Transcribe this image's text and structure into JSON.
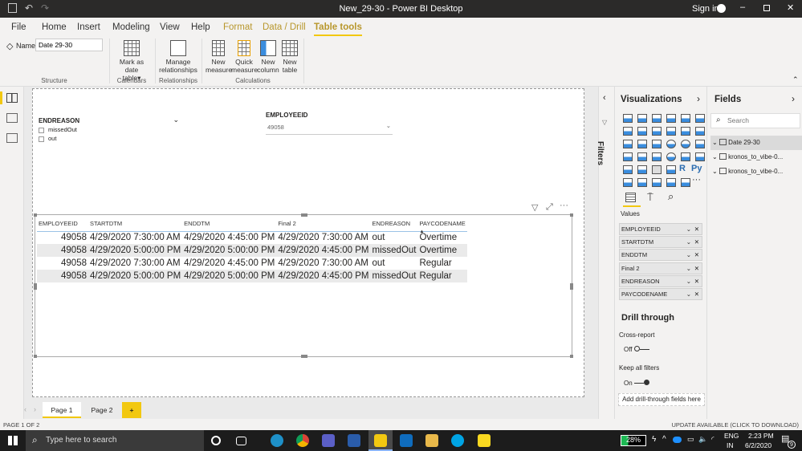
{
  "window": {
    "title": "New_29-30 - Power BI Desktop",
    "signin": "Sign in"
  },
  "menu": [
    "File",
    "Home",
    "Insert",
    "Modeling",
    "View",
    "Help",
    "Format",
    "Data / Drill",
    "Table tools"
  ],
  "ribbon": {
    "name_label": "Name",
    "name_value": "Date 29-30",
    "buttons": {
      "mark_date": "Mark as date",
      "mark_date2": "table",
      "manage": "Manage",
      "manage2": "relationships",
      "new_measure": "New",
      "new_measure2": "measure",
      "quick_measure": "Quick",
      "quick_measure2": "measure",
      "new_column": "New",
      "new_column2": "column",
      "new_table": "New",
      "new_table2": "table"
    },
    "groups": {
      "structure": "Structure",
      "calendars": "Calendars",
      "relationships": "Relationships",
      "calculations": "Calculations"
    }
  },
  "slicer1": {
    "title": "ENDREASON",
    "items": [
      "missedOut",
      "out"
    ]
  },
  "slicer2": {
    "title": "EMPLOYEEID",
    "value": "49058"
  },
  "table": {
    "columns": [
      "EMPLOYEEID",
      "STARTDTM",
      "ENDDTM",
      "Final 2",
      "ENDREASON",
      "PAYCODENAME"
    ],
    "rows": [
      [
        "49058",
        "4/29/2020 7:30:00 AM",
        "4/29/2020 4:45:00 PM",
        "4/29/2020 7:30:00 AM",
        "out",
        "Overtime"
      ],
      [
        "49058",
        "4/29/2020 5:00:00 PM",
        "4/29/2020 5:00:00 PM",
        "4/29/2020 4:45:00 PM",
        "missedOut",
        "Overtime"
      ],
      [
        "49058",
        "4/29/2020 7:30:00 AM",
        "4/29/2020 4:45:00 PM",
        "4/29/2020 7:30:00 AM",
        "out",
        "Regular"
      ],
      [
        "49058",
        "4/29/2020 5:00:00 PM",
        "4/29/2020 5:00:00 PM",
        "4/29/2020 4:45:00 PM",
        "missedOut",
        "Regular"
      ]
    ]
  },
  "filters": {
    "label": "Filters"
  },
  "visualizations": {
    "title": "Visualizations",
    "r_label": "R",
    "py_label": "Py",
    "more": "···",
    "values_label": "Values",
    "wells": [
      "EMPLOYEEID",
      "STARTDTM",
      "ENDDTM",
      "Final 2",
      "ENDREASON",
      "PAYCODENAME"
    ],
    "drill": {
      "title": "Drill through",
      "cross": "Cross-report",
      "cross_state": "Off",
      "keep": "Keep all filters",
      "keep_state": "On",
      "add": "Add drill-through fields here"
    }
  },
  "fields": {
    "title": "Fields",
    "search_placeholder": "Search",
    "items": [
      "Date 29-30",
      "kronos_to_vibe-0...",
      "kronos_to_vibe-0..."
    ]
  },
  "pages": {
    "tabs": [
      "Page 1",
      "Page 2"
    ],
    "add": "+",
    "active": 0
  },
  "status": {
    "page": "PAGE 1 OF 2",
    "update": "UPDATE AVAILABLE (CLICK TO DOWNLOAD)"
  },
  "taskbar": {
    "search": "Type here to search",
    "battery": "28%",
    "lang1": "ENG",
    "lang2": "IN",
    "time": "2:23 PM",
    "date": "6/2/2020",
    "notif": "9"
  },
  "colors": {
    "accent": "#f2c811",
    "titlebar": "#2b2a29",
    "context_tab": "#b8972c"
  }
}
